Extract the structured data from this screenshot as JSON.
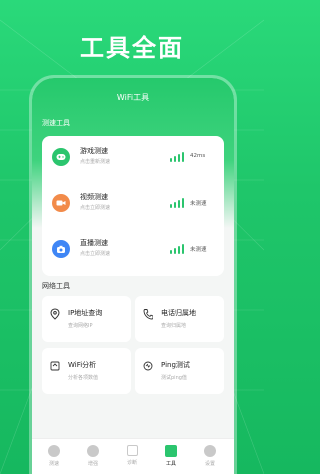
{
  "headline": "工具全面",
  "appbar": {
    "title": "WiFi工具"
  },
  "speed_section": {
    "label": "测速工具",
    "items": [
      {
        "name": "游戏测速",
        "sub": "点击重新测速",
        "value": "42ms",
        "icon": "gamepad-icon",
        "color": "#2bc56e"
      },
      {
        "name": "视频测速",
        "sub": "点击立即测速",
        "value": "未测速",
        "icon": "video-icon",
        "color": "#f28b4a"
      },
      {
        "name": "直播测速",
        "sub": "点击立即测速",
        "value": "未测速",
        "icon": "live-camera-icon",
        "color": "#3f86f5"
      }
    ]
  },
  "network_section": {
    "label": "网络工具",
    "tools": [
      {
        "name": "IP地址查询",
        "sub": "查询网络IP",
        "icon": "location-pin-icon"
      },
      {
        "name": "电话归属地",
        "sub": "查询归属地",
        "icon": "phone-icon"
      },
      {
        "name": "WiFi分析",
        "sub": "分析各项数值",
        "icon": "wifi-analysis-icon"
      },
      {
        "name": "Ping测试",
        "sub": "测试ping值",
        "icon": "ping-icon"
      }
    ]
  },
  "tabbar": {
    "tabs": [
      {
        "label": "测速",
        "icon": "speed-icon"
      },
      {
        "label": "增强",
        "icon": "boost-icon"
      },
      {
        "label": "诊断",
        "icon": "diagnose-icon"
      },
      {
        "label": "工具",
        "icon": "toolbox-icon",
        "active": true
      },
      {
        "label": "设置",
        "icon": "gear-icon"
      }
    ]
  }
}
